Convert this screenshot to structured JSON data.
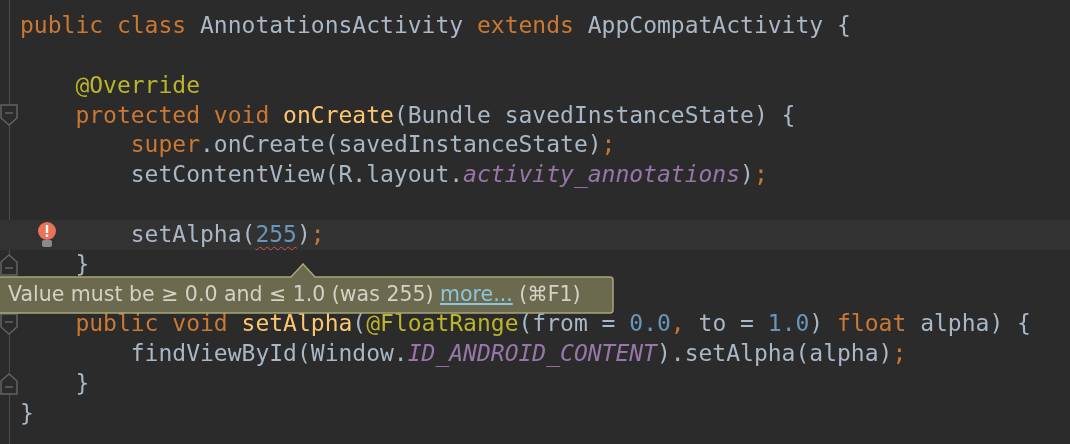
{
  "editor": {
    "lines": [
      {
        "kind": "code",
        "tokens": [
          {
            "t": "public class ",
            "kind": "keyword"
          },
          {
            "t": "AnnotationsActivity ",
            "kind": "plain"
          },
          {
            "t": "extends ",
            "kind": "keyword"
          },
          {
            "t": "AppCompatActivity {",
            "kind": "plain"
          }
        ],
        "children": [
          {
            "kind": "blank"
          },
          {
            "kind": "code",
            "tokens": [
              {
                "t": "@Override",
                "kind": "annotation"
              }
            ]
          },
          {
            "kind": "code",
            "fold_start": true,
            "tokens": [
              {
                "t": "protected void ",
                "kind": "keyword"
              },
              {
                "t": "onCreate",
                "kind": "declaration"
              },
              {
                "t": "(Bundle savedInstanceState) {",
                "kind": "plain"
              }
            ],
            "children": [
              {
                "kind": "code",
                "tokens": [
                  {
                    "t": "super",
                    "kind": "keyword"
                  },
                  {
                    "t": ".onCreate(savedInstanceState)",
                    "kind": "plain"
                  },
                  {
                    "t": ";",
                    "kind": "keyword"
                  }
                ]
              },
              {
                "kind": "code",
                "tokens": [
                  {
                    "t": "setContentView(R.layout.",
                    "kind": "plain"
                  },
                  {
                    "t": "activity_annotations",
                    "kind": "constant"
                  },
                  {
                    "t": ")",
                    "kind": "plain"
                  },
                  {
                    "t": ";",
                    "kind": "keyword"
                  }
                ]
              },
              {
                "kind": "blank"
              },
              {
                "kind": "code",
                "current": true,
                "warning": true,
                "tokens": [
                  {
                    "t": "setAlpha(",
                    "kind": "plain"
                  },
                  {
                    "t": "255",
                    "kind": "number",
                    "squiggle": true
                  },
                  {
                    "t": ")",
                    "kind": "plain"
                  },
                  {
                    "t": ";",
                    "kind": "keyword"
                  }
                ]
              }
            ]
          },
          {
            "kind": "code",
            "fold_end": true,
            "tokens": [
              {
                "t": "}",
                "kind": "plain"
              }
            ]
          },
          {
            "kind": "blank"
          },
          {
            "kind": "code",
            "fold_start": true,
            "tokens": [
              {
                "t": "public void ",
                "kind": "keyword"
              },
              {
                "t": "setAlpha",
                "kind": "declaration"
              },
              {
                "t": "(",
                "kind": "plain"
              },
              {
                "t": "@FloatRange",
                "kind": "annotation"
              },
              {
                "t": "(from = ",
                "kind": "plain"
              },
              {
                "t": "0.0",
                "kind": "number"
              },
              {
                "t": ", ",
                "kind": "keyword"
              },
              {
                "t": "to = ",
                "kind": "plain"
              },
              {
                "t": "1.0",
                "kind": "number"
              },
              {
                "t": ") ",
                "kind": "plain"
              },
              {
                "t": "float ",
                "kind": "keyword"
              },
              {
                "t": "alpha) {",
                "kind": "plain"
              }
            ],
            "children": [
              {
                "kind": "code",
                "tokens": [
                  {
                    "t": "findViewById(Window.",
                    "kind": "plain"
                  },
                  {
                    "t": "ID_ANDROID_CONTENT",
                    "kind": "constant"
                  },
                  {
                    "t": ").setAlpha(alpha)",
                    "kind": "plain"
                  },
                  {
                    "t": ";",
                    "kind": "keyword"
                  }
                ]
              }
            ]
          },
          {
            "kind": "code",
            "fold_end": true,
            "tokens": [
              {
                "t": "}",
                "kind": "plain"
              }
            ]
          }
        ]
      },
      {
        "kind": "code",
        "tokens": [
          {
            "t": "}",
            "kind": "plain"
          }
        ]
      }
    ]
  },
  "tooltip": {
    "message": "Value must be ≥ 0.0 and ≤ 1.0 (was 255)",
    "link": "more...",
    "shortcut": "(⌘F1)"
  }
}
